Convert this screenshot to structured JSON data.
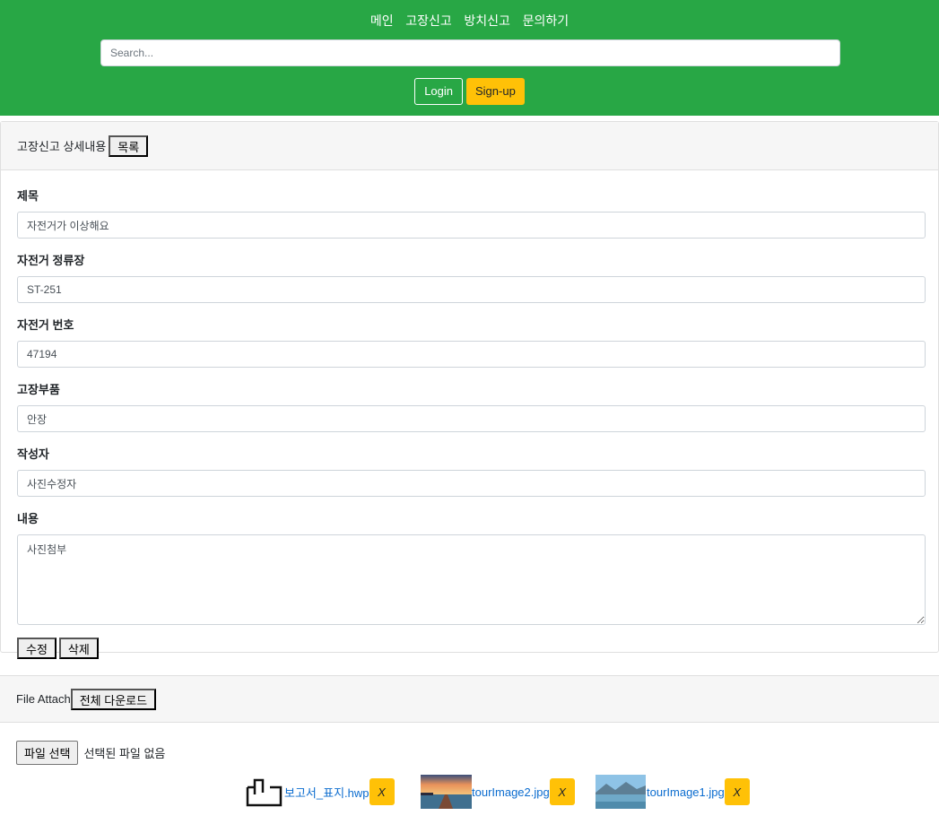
{
  "nav": {
    "items": [
      "메인",
      "고장신고",
      "방치신고",
      "문의하기"
    ]
  },
  "search": {
    "placeholder": "Search..."
  },
  "auth": {
    "login": "Login",
    "signup": "Sign-up"
  },
  "detail": {
    "title": "고장신고 상세내용",
    "list_button": "목록",
    "fields": {
      "subject": {
        "label": "제목",
        "value": "자전거가 이상해요"
      },
      "station": {
        "label": "자전거 정류장",
        "value": "ST-251"
      },
      "bike_number": {
        "label": "자전거 번호",
        "value": "47194"
      },
      "broken_part": {
        "label": "고장부품",
        "value": "안장"
      },
      "author": {
        "label": "작성자",
        "value": "사진수정자"
      },
      "content": {
        "label": "내용",
        "value": "사진첨부"
      }
    },
    "edit_button": "수정",
    "delete_button": "삭제"
  },
  "files": {
    "title": "File Attach",
    "download_all": "전체 다운로드",
    "choose_button": "파일 선택",
    "no_file_text": "선택된 파일 없음",
    "attachments": [
      {
        "name": "보고서_표지.hwp",
        "icon": "file-icon",
        "remove": "X"
      },
      {
        "name": "tourImage2.jpg",
        "icon": "pier-sunset-thumbnail",
        "remove": "X"
      },
      {
        "name": "tourImage1.jpg",
        "icon": "lake-mountain-thumbnail",
        "remove": "X"
      }
    ]
  },
  "colors": {
    "header": "#28a745",
    "signup": "#ffc107",
    "link": "#0b6ccf"
  }
}
